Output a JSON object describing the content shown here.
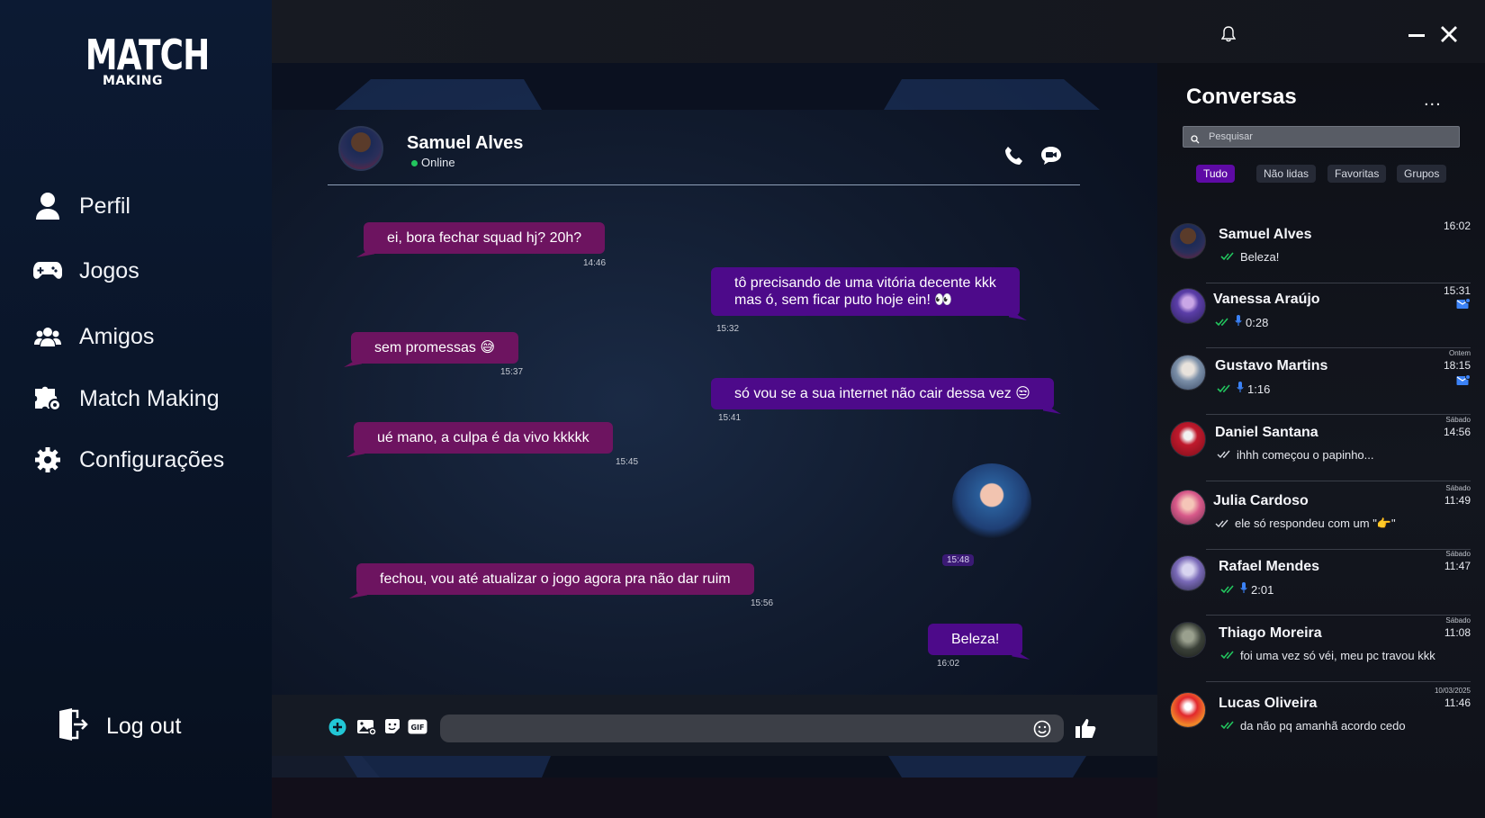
{
  "app": {
    "logo_top": "MATCH",
    "logo_bottom": "MAKING"
  },
  "sidebar": {
    "items": [
      {
        "label": "Perfil"
      },
      {
        "label": "Jogos"
      },
      {
        "label": "Amigos"
      },
      {
        "label": "Match Making"
      },
      {
        "label": "Configurações"
      }
    ],
    "logout_label": "Log out"
  },
  "chat": {
    "contact_name": "Samuel Alves",
    "contact_status": "Online",
    "messages": [
      {
        "dir": "in",
        "text": "ei, bora fechar squad hj? 20h?",
        "time": "14:46"
      },
      {
        "dir": "out",
        "text": "tô precisando de uma vitória decente kkk",
        "text2": "mas ó, sem ficar puto hoje ein! 👀",
        "time": "15:32"
      },
      {
        "dir": "in",
        "text": "sem promessas 😅",
        "time": "15:37"
      },
      {
        "dir": "out",
        "text": "só vou se a sua internet não cair dessa vez 😒",
        "time": "15:41"
      },
      {
        "dir": "in",
        "text": "ué mano, a culpa é da vivo kkkkk",
        "time": "15:45"
      },
      {
        "dir": "out",
        "type": "sticker",
        "time": "15:48"
      },
      {
        "dir": "in",
        "text": "fechou, vou até atualizar o jogo agora pra não dar ruim",
        "time": "15:56"
      },
      {
        "dir": "out",
        "text": "Beleza!",
        "time": "16:02"
      }
    ],
    "composer": {
      "placeholder": "",
      "gif_label": "GIF"
    }
  },
  "conversations": {
    "title": "Conversas",
    "more_label": "...",
    "search_placeholder": "Pesquisar",
    "filters": [
      "Tudo",
      "Não lidas",
      "Favoritas",
      "Grupos"
    ],
    "active_filter": "Tudo",
    "items": [
      {
        "name": "Samuel Alves",
        "preview": "Beleza!",
        "day": "",
        "time": "16:02",
        "audio": false,
        "unread": false,
        "read": true
      },
      {
        "name": "Vanessa Araújo",
        "preview": "0:28",
        "day": "",
        "time": "15:31",
        "audio": true,
        "unread": true,
        "read": true
      },
      {
        "name": "Gustavo Martins",
        "preview": "1:16",
        "day": "Ontem",
        "time": "18:15",
        "audio": true,
        "unread": true,
        "read": true
      },
      {
        "name": "Daniel Santana",
        "preview": "ihhh começou o papinho...",
        "day": "Sábado",
        "time": "14:56",
        "audio": false,
        "unread": false,
        "read": false
      },
      {
        "name": "Julia Cardoso",
        "preview": "ele só respondeu com um \"👉\"",
        "day": "Sábado",
        "time": "11:49",
        "audio": false,
        "unread": false,
        "read": false
      },
      {
        "name": "Rafael Mendes",
        "preview": "2:01",
        "day": "Sábado",
        "time": "11:47",
        "audio": true,
        "unread": false,
        "read": true
      },
      {
        "name": "Thiago Moreira",
        "preview": "foi uma vez só véi, meu pc travou kkk",
        "day": "Sábado",
        "time": "11:08",
        "audio": false,
        "unread": false,
        "read": true
      },
      {
        "name": "Lucas Oliveira",
        "preview": "da não  pq amanhã acordo cedo",
        "day": "10/03/2025",
        "time": "11:46",
        "audio": false,
        "unread": false,
        "read": true
      }
    ]
  },
  "colors": {
    "incoming_bubble": "#6d1460",
    "outgoing_bubble": "#4d0a8a",
    "accent": "#5e0aa5",
    "read_check": "#22c55e",
    "audio_mic": "#3b82f6"
  }
}
